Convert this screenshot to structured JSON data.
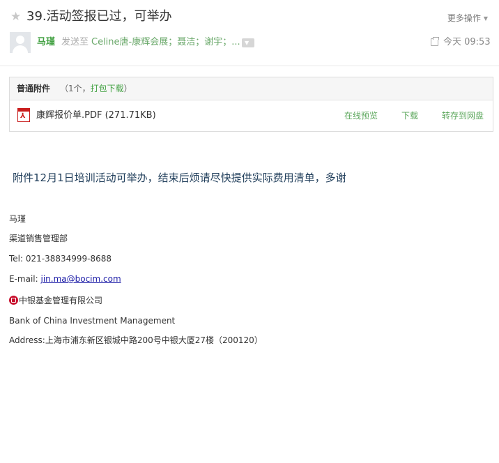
{
  "header": {
    "subject": "39.活动签报已过，可举办",
    "more_ops": "更多操作",
    "sender": "马瑾",
    "sendto_label": "发送至",
    "recipients": "Celine唐-康辉会展；聂洁；谢宇；...",
    "time": "今天 09:53"
  },
  "attachments": {
    "title": "普通附件",
    "count_prefix": "（1个，",
    "pack_download": "打包下载",
    "count_suffix": "）",
    "file": {
      "icon": "pdf-icon",
      "name": "康辉报价单.PDF (271.71KB)",
      "preview": "在线预览",
      "download": "下载",
      "save_to_disk": "转存到网盘"
    }
  },
  "body": {
    "text": "附件12月1日培训活动可举办，结束后烦请尽快提供实际费用清单，多谢"
  },
  "signature": {
    "name": "马瑾",
    "dept": "渠道销售管理部",
    "tel": "Tel:  021-38834999-8688",
    "email_label": "E-mail: ",
    "email": "jin.ma@bocim.com",
    "company_cn": "中银基金管理有限公司",
    "company_en": "Bank of China Investment Management",
    "address": "Address:上海市浦东新区银城中路200号中银大厦27楼（200120）"
  },
  "colors": {
    "accent_green": "#46a346",
    "link_blue": "#1a1aa6",
    "body_text": "#1f3d5a"
  }
}
